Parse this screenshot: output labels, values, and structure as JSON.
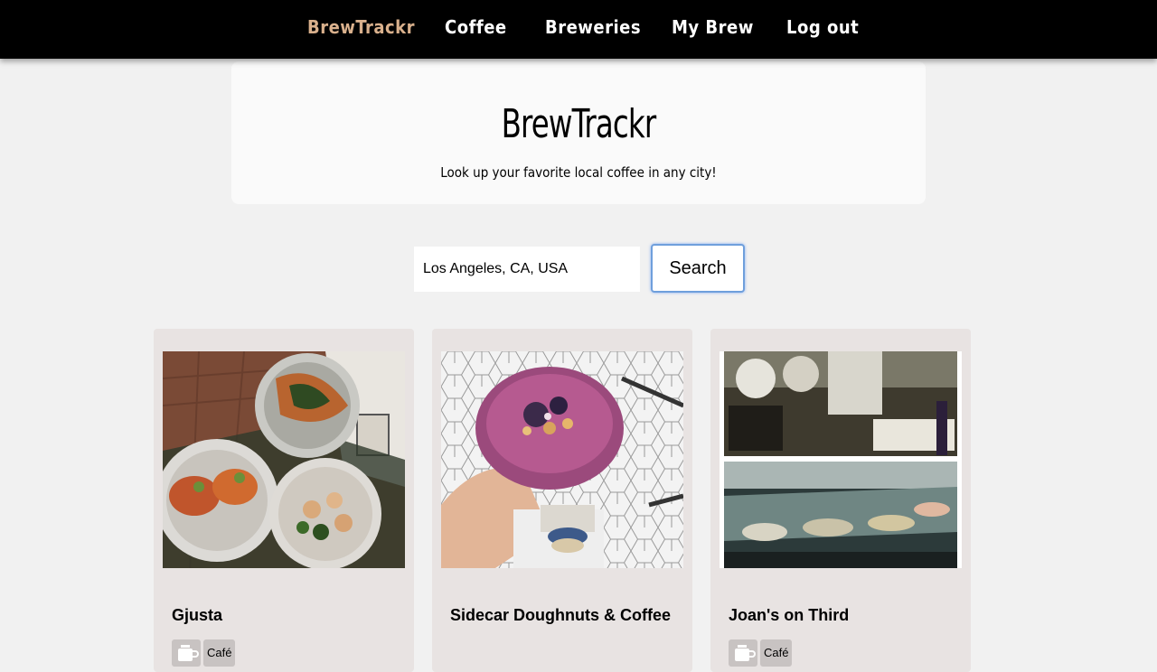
{
  "nav": {
    "brand": "BrewTrackr",
    "items": [
      "Coffee",
      "Breweries",
      "My Brew",
      "Log out"
    ]
  },
  "hero": {
    "title": "BrewTrackr",
    "subtitle": "Look up your favorite local coffee in any city!"
  },
  "search": {
    "value": "Los Angeles, CA, USA",
    "button_label": "Search"
  },
  "cards": [
    {
      "name": "Gjusta",
      "category": "Café",
      "category_icon": "coffee-cup-icon"
    },
    {
      "name": "Sidecar Doughnuts & Coffee",
      "category": "Café",
      "category_icon": "coffee-cup-icon"
    },
    {
      "name": "Joan's on Third",
      "category": "Café",
      "category_icon": "coffee-cup-icon"
    }
  ],
  "colors": {
    "nav_bg": "#000000",
    "brand_accent": "#d9b08c",
    "page_bg": "#f1f1f1",
    "card_bg": "#e8e3e2",
    "tag_bg": "#c8c3c2",
    "focus_ring": "#6f9fdc"
  }
}
